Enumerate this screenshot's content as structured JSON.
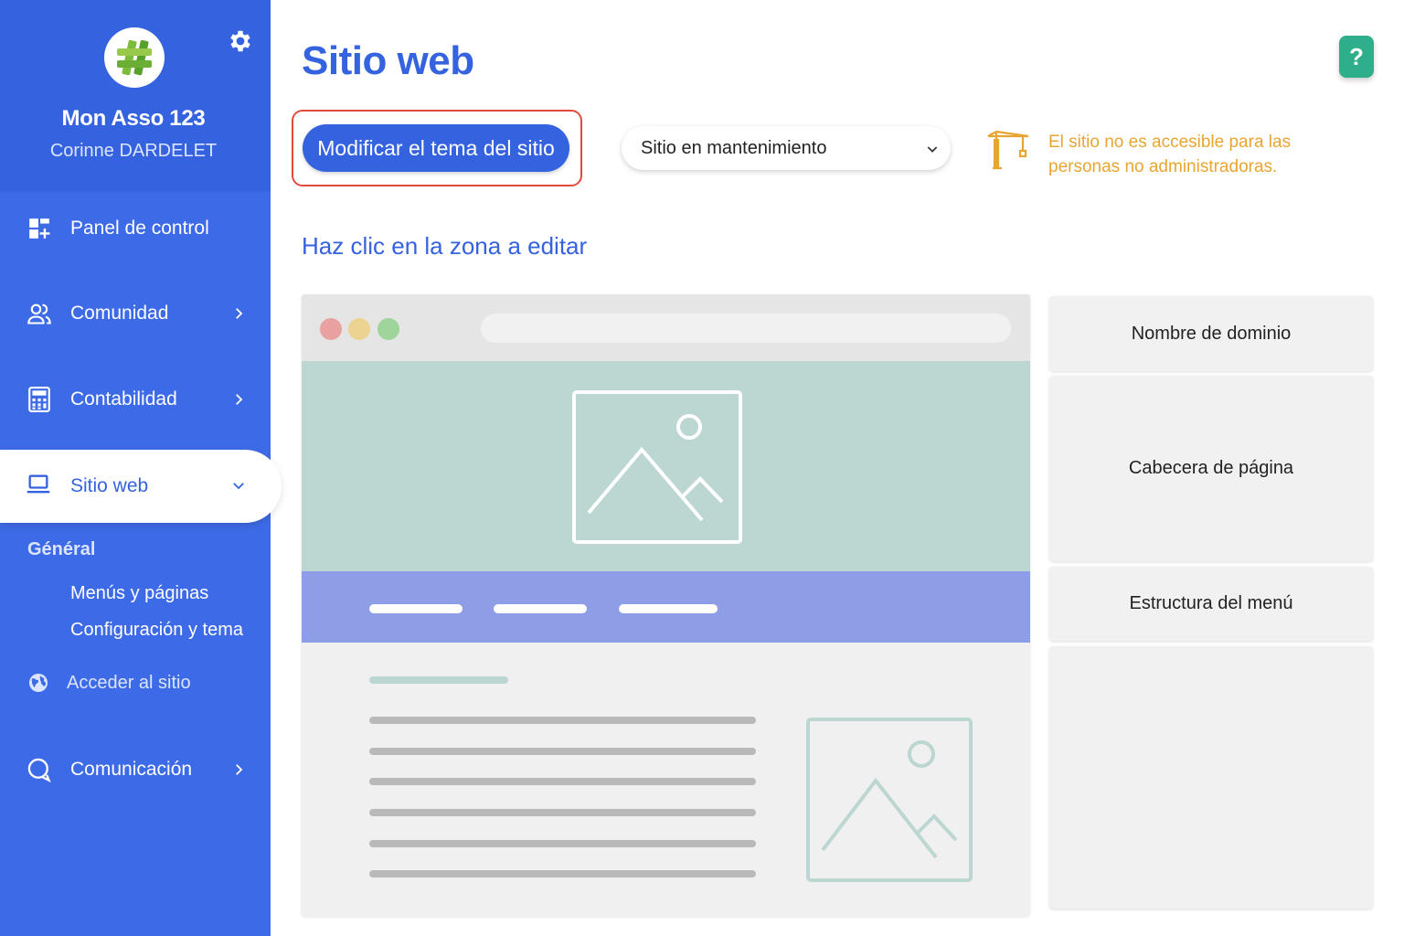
{
  "sidebar": {
    "org_name": "Mon Asso 123",
    "user_name": "Corinne DARDELET",
    "items": [
      {
        "label": "Panel de control",
        "icon": "dashboard-icon"
      },
      {
        "label": "Comunidad",
        "icon": "community-icon"
      },
      {
        "label": "Contabilidad",
        "icon": "calculator-icon"
      },
      {
        "label": "Sitio web",
        "icon": "laptop-icon"
      },
      {
        "label": "Comunicación",
        "icon": "chat-icon"
      }
    ],
    "sub_heading": "Général",
    "sub_links": [
      "Menús y páginas",
      "Configuración y tema"
    ],
    "access_label": "Acceder al sitio"
  },
  "header": {
    "title": "Sitio web",
    "help_label": "?"
  },
  "toolbar": {
    "modify_theme_label": "Modificar el tema del sitio",
    "site_status_value": "Sitio en mantenimiento",
    "warning_text": "El sitio no es accesible para las personas no administradoras."
  },
  "editor": {
    "instruction": "Haz clic en la zona a editar",
    "zones": [
      "Nombre de dominio",
      "Cabecera de página",
      "Estructura del menú"
    ]
  },
  "colors": {
    "brand": "#3563e0",
    "sidebar": "#3d6ae6",
    "warning": "#e8a531",
    "help": "#2eae8a",
    "highlight": "#e04c3c"
  }
}
